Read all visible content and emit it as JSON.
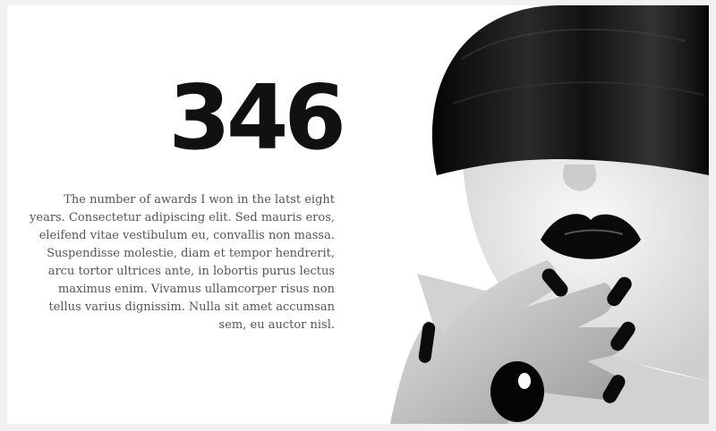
{
  "stat": {
    "number": "346",
    "text": "The number of awards I won in the latst eight years. Consectetur adipiscing elit. Sed mauris eros, eleifend vitae vestibulum eu, convallis non massa. Suspendisse molestie, diam et tempor hendrerit, arcu tortor ultrices ante, in lobortis purus lectus maximus enim. Vivamus ullamcorper risus non tellus varius dignissim. Nulla sit amet accumsan sem, eu auctor nisl."
  },
  "image": {
    "subject": "black-and-white portrait with black bob haircut, black lips and black nails"
  }
}
